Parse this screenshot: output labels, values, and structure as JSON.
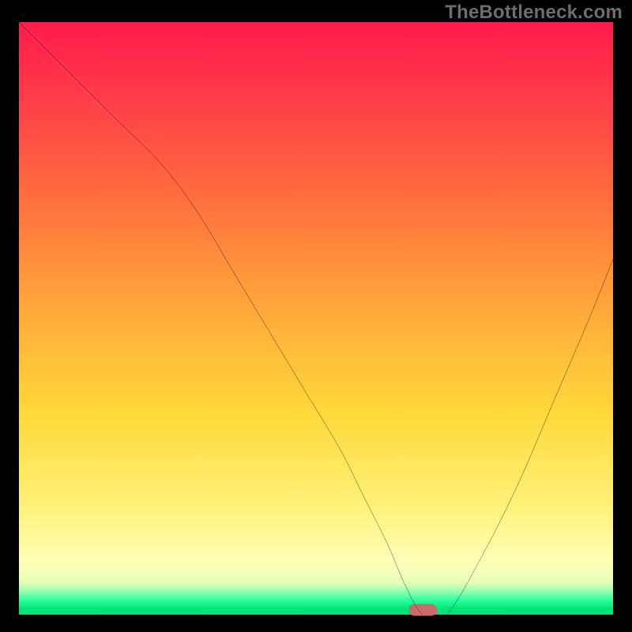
{
  "watermark": "TheBottleneck.com",
  "colors": {
    "frame": "#000000",
    "curve": "#000000",
    "marker": "#c96b6b",
    "watermark_text": "#6d6d6d"
  },
  "chart_data": {
    "type": "line",
    "title": "",
    "xlabel": "",
    "ylabel": "",
    "xlim": [
      0,
      100
    ],
    "ylim": [
      0,
      100
    ],
    "grid": false,
    "legend": false,
    "annotations": [],
    "marker": {
      "x": 68,
      "y": 0,
      "color": "#c96b6b"
    },
    "series": [
      {
        "name": "bottleneck-curve",
        "x": [
          0,
          8,
          16,
          24,
          30,
          36,
          42,
          48,
          54,
          58,
          62,
          65,
          68,
          72,
          78,
          84,
          90,
          96,
          100
        ],
        "y": [
          100,
          92,
          84,
          76,
          68,
          58,
          48,
          38,
          28,
          20,
          12,
          5,
          0,
          0,
          10,
          22,
          36,
          50,
          60
        ]
      }
    ],
    "background_gradient": {
      "direction": "top-to-bottom",
      "stops": [
        {
          "pos": 0.0,
          "color": "#ff1a4b"
        },
        {
          "pos": 0.12,
          "color": "#ff3a4a"
        },
        {
          "pos": 0.3,
          "color": "#ff6f3e"
        },
        {
          "pos": 0.48,
          "color": "#ffa73a"
        },
        {
          "pos": 0.66,
          "color": "#ffd93a"
        },
        {
          "pos": 0.82,
          "color": "#fff27a"
        },
        {
          "pos": 0.91,
          "color": "#ffffb8"
        },
        {
          "pos": 0.945,
          "color": "#e8ffb8"
        },
        {
          "pos": 0.96,
          "color": "#99ffb0"
        },
        {
          "pos": 0.975,
          "color": "#2fffa0"
        },
        {
          "pos": 0.99,
          "color": "#00e676"
        },
        {
          "pos": 1.0,
          "color": "#00e676"
        }
      ]
    }
  }
}
